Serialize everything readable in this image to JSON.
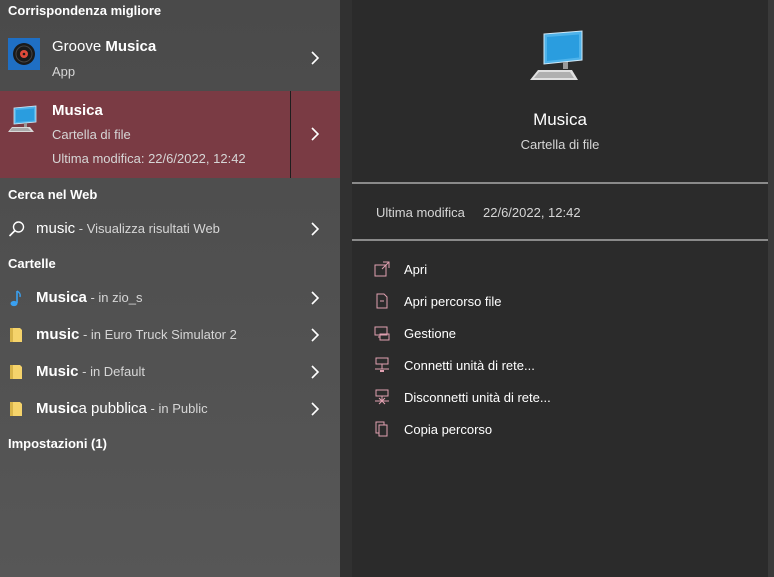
{
  "colors": {
    "selected_bg": "#7a3b44",
    "action_icon": "#e0a0b0",
    "folder_yellow": "#f5d36b",
    "music_note": "#3aa0f0"
  },
  "left": {
    "best_match_header": "Corrispondenza migliore",
    "best_match": [
      {
        "title_bold": "Musica",
        "title_prefix": "Groove ",
        "title_suffix": "",
        "subtitle": "App",
        "icon": "groove-music-icon"
      },
      {
        "title_bold": "Musica",
        "title_prefix": "",
        "title_suffix": "",
        "subtitle": "Cartella di file",
        "subtitle2": "Ultima modifica: 22/6/2022, 12:42",
        "icon": "computer-icon"
      }
    ],
    "web_header": "Cerca nel Web",
    "web_result": {
      "term": "music",
      "suffix": " - Visualizza risultati Web",
      "icon": "search-icon"
    },
    "folders_header": "Cartelle",
    "folders": [
      {
        "bold": "Musica",
        "rest": "",
        "suffix": " - in zio_s",
        "icon": "music-note-icon"
      },
      {
        "bold": "music",
        "rest": "",
        "suffix": " - in Euro Truck Simulator 2",
        "icon": "folder-icon"
      },
      {
        "bold": "Music",
        "rest": "",
        "suffix": " - in Default",
        "icon": "folder-icon"
      },
      {
        "bold": "Music",
        "rest": "a pubblica",
        "suffix": " - in Public",
        "icon": "folder-icon"
      }
    ],
    "settings_header": "Impostazioni (1)"
  },
  "detail": {
    "title": "Musica",
    "subtitle": "Cartella di file",
    "meta_label": "Ultima modifica",
    "meta_value": "22/6/2022, 12:42",
    "actions": [
      {
        "label": "Apri",
        "icon": "open-icon"
      },
      {
        "label": "Apri percorso file",
        "icon": "file-location-icon"
      },
      {
        "label": "Gestione",
        "icon": "manage-icon"
      },
      {
        "label": "Connetti unità di rete...",
        "icon": "map-drive-icon"
      },
      {
        "label": "Disconnetti unità di rete...",
        "icon": "disconnect-drive-icon"
      },
      {
        "label": "Copia percorso",
        "icon": "copy-path-icon"
      }
    ]
  }
}
